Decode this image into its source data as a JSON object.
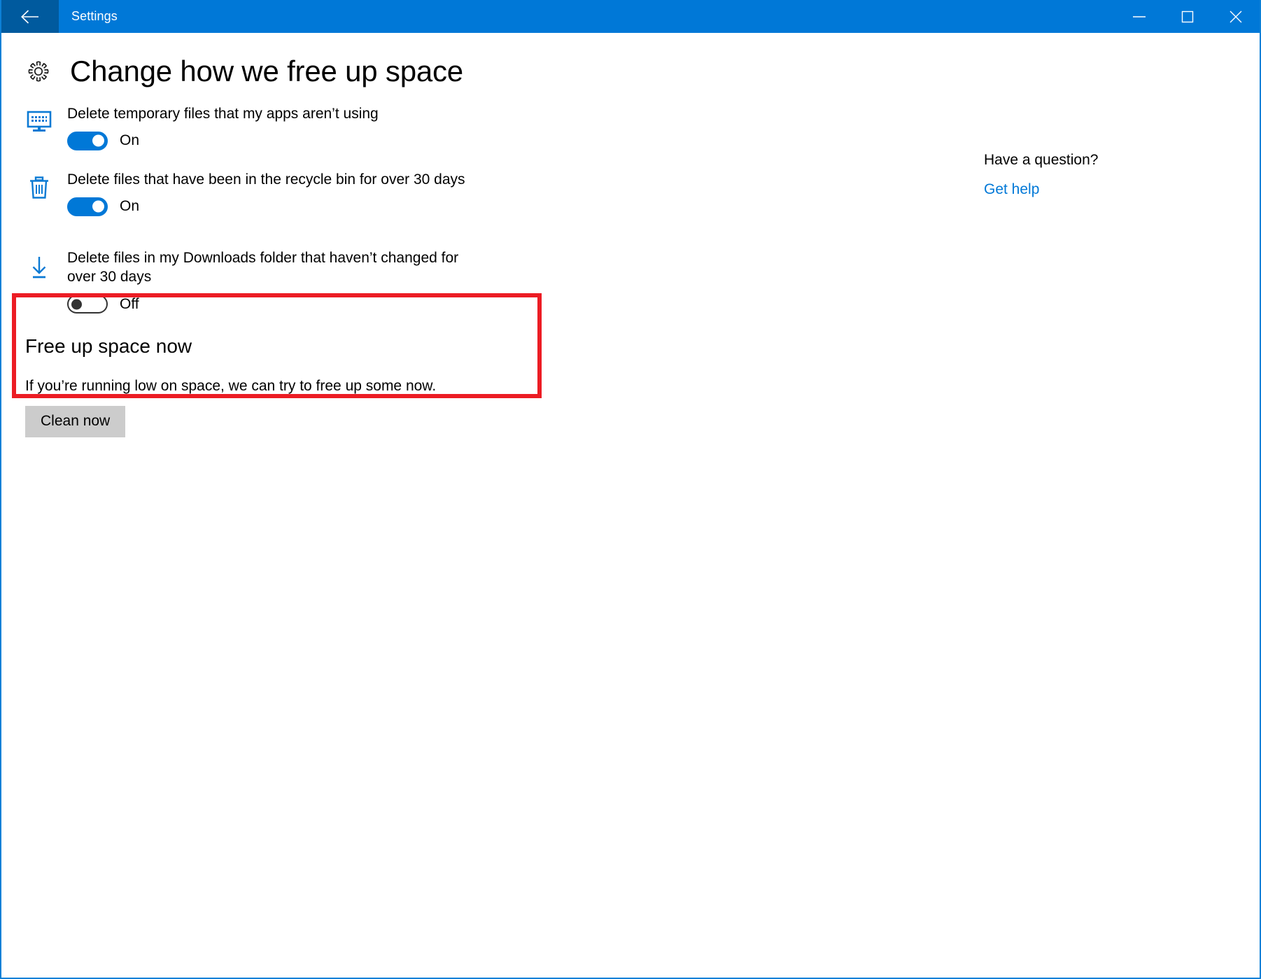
{
  "window": {
    "title": "Settings",
    "back_icon": "back-arrow-icon",
    "minimize_label": "Minimize",
    "maximize_label": "Maximize",
    "close_label": "Close",
    "accent_color": "#0078d7",
    "back_button_color": "#005a9e",
    "border_color": "#0c80d7"
  },
  "page": {
    "icon": "gear-icon",
    "title": "Change how we free up space"
  },
  "settings": [
    {
      "icon": "monitor-apps-icon",
      "label": "Delete temporary files that my apps aren’t using",
      "toggle_state": "On",
      "toggle_on": true,
      "highlighted": false
    },
    {
      "icon": "recycle-bin-icon",
      "label": "Delete files that have been in the recycle bin for over 30 days",
      "toggle_state": "On",
      "toggle_on": true,
      "highlighted": false
    },
    {
      "icon": "download-icon",
      "label": "Delete files in my Downloads folder that haven’t changed for over 30 days",
      "toggle_state": "Off",
      "toggle_on": false,
      "highlighted": true
    }
  ],
  "highlight": {
    "color": "#ec1c24"
  },
  "free_up_section": {
    "title": "Free up space now",
    "description": "If you’re running low on space, we can try to free up some now.",
    "button_label": "Clean now"
  },
  "help": {
    "title": "Have a question?",
    "link_label": "Get help",
    "link_color": "#0078d7"
  }
}
